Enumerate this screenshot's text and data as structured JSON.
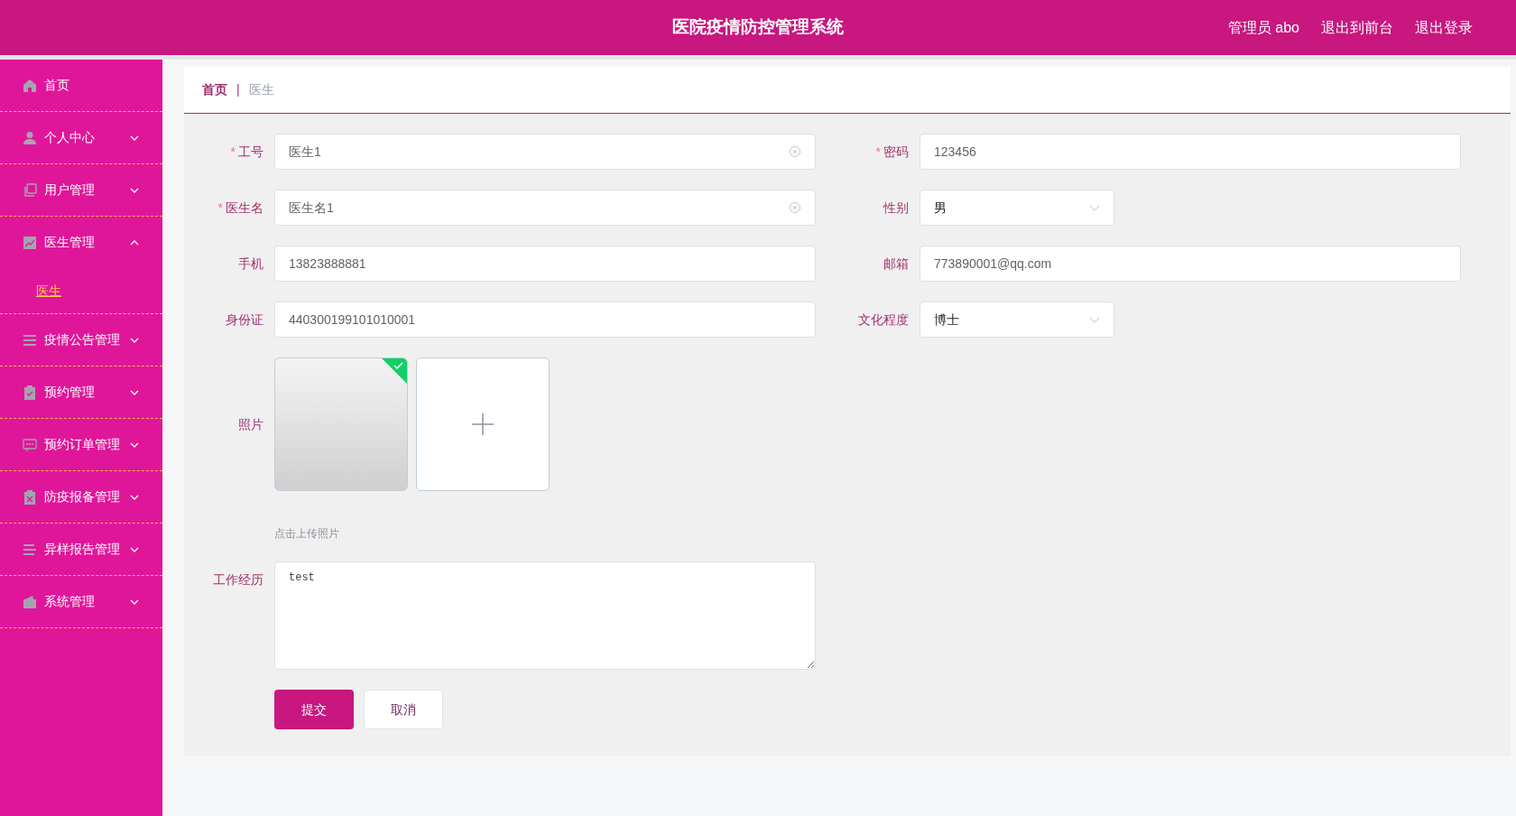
{
  "header": {
    "title": "医院疫情防控管理系统",
    "links": [
      "管理员 abo",
      "退出到前台",
      "退出登录"
    ]
  },
  "sidebar": {
    "items": [
      {
        "label": "首页",
        "expandable": false
      },
      {
        "label": "个人中心",
        "expandable": true,
        "expanded": false
      },
      {
        "label": "用户管理",
        "expandable": true,
        "expanded": false
      },
      {
        "label": "医生管理",
        "expandable": true,
        "expanded": true,
        "children": [
          {
            "label": "医生",
            "selected": true
          }
        ]
      },
      {
        "label": "疫情公告管理",
        "expandable": true,
        "expanded": false
      },
      {
        "label": "预约管理",
        "expandable": true,
        "expanded": false
      },
      {
        "label": "预约订单管理",
        "expandable": true,
        "expanded": false
      },
      {
        "label": "防疫报备管理",
        "expandable": true,
        "expanded": false
      },
      {
        "label": "异样报告管理",
        "expandable": true,
        "expanded": false
      },
      {
        "label": "系统管理",
        "expandable": true,
        "expanded": false
      }
    ]
  },
  "breadcrumb": {
    "items": [
      "首页",
      "医生"
    ],
    "separator": "|"
  },
  "form": {
    "rows": [
      {
        "fields": [
          {
            "kind": "input",
            "label": "工号",
            "required_mark": "*",
            "value": "医生1",
            "clearable": true
          },
          {
            "kind": "input",
            "label": "密码",
            "required_mark": "*",
            "value": "123456",
            "clearable": false
          }
        ]
      },
      {
        "fields": [
          {
            "kind": "input",
            "label": "医生名",
            "required_mark": "*",
            "value": "医生名1",
            "clearable": true
          },
          {
            "kind": "select",
            "label": "性别",
            "value": "男"
          }
        ]
      },
      {
        "fields": [
          {
            "kind": "input",
            "label": "手机",
            "value": "13823888881",
            "clearable": false
          },
          {
            "kind": "input",
            "label": "邮箱",
            "value": "773890001@qq.com",
            "clearable": false
          }
        ]
      },
      {
        "fields": [
          {
            "kind": "input",
            "label": "身份证",
            "value": "440300199101010001",
            "clearable": false
          },
          {
            "kind": "select",
            "label": "文化程度",
            "value": "博士"
          }
        ]
      },
      {
        "fields": [
          {
            "kind": "upload",
            "label": "照片",
            "uploaded": true,
            "hint": "点击上传照片"
          }
        ]
      },
      {
        "fields": [
          {
            "kind": "textarea",
            "label": "工作经历",
            "value": "test"
          }
        ]
      }
    ],
    "buttons": [
      {
        "label": "提交",
        "primary": true
      },
      {
        "label": "取消",
        "primary": false
      }
    ]
  }
}
